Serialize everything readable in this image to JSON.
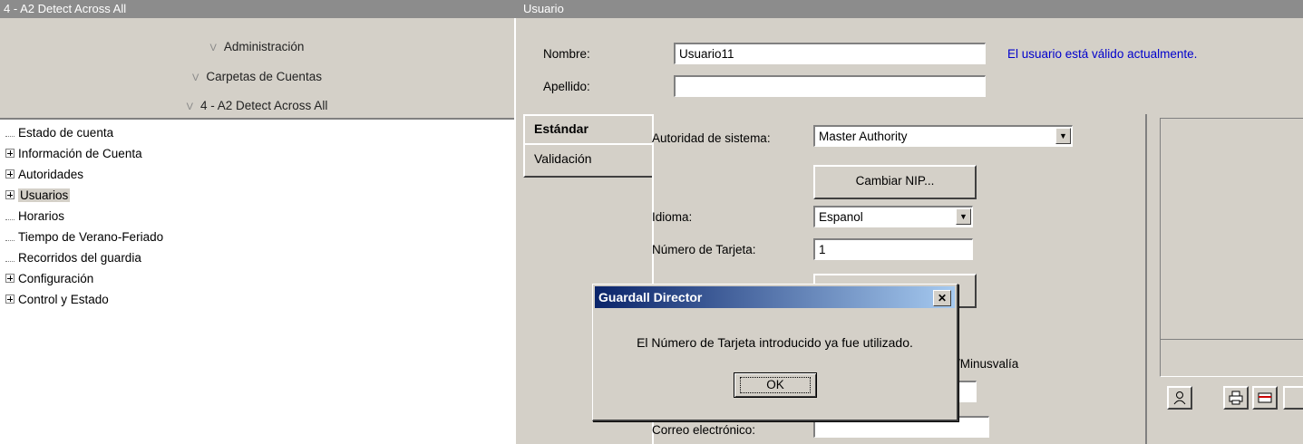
{
  "left": {
    "title": "4 - A2 Detect Across All",
    "nav": [
      "Administración",
      "Carpetas de Cuentas",
      "4 - A2 Detect Across All"
    ],
    "tree": [
      {
        "label": "Estado de cuenta",
        "expandable": false
      },
      {
        "label": "Información de Cuenta",
        "expandable": true
      },
      {
        "label": "Autoridades",
        "expandable": true
      },
      {
        "label": "Usuarios",
        "expandable": true,
        "selected": true
      },
      {
        "label": "Horarios",
        "expandable": false
      },
      {
        "label": "Tiempo de Verano-Feriado",
        "expandable": false
      },
      {
        "label": "Recorridos del guardia",
        "expandable": false
      },
      {
        "label": "Configuración",
        "expandable": true
      },
      {
        "label": "Control y Estado",
        "expandable": true
      }
    ]
  },
  "right": {
    "title": "Usuario",
    "nombre_label": "Nombre:",
    "nombre_value": "Usuario11",
    "apellido_label": "Apellido:",
    "apellido_value": "",
    "status": "El usuario está válido actualmente.",
    "tabs": [
      "Estándar",
      "Validación"
    ],
    "autoridad_label": "Autoridad de sistema:",
    "autoridad_value": "Master Authority",
    "cambiar_nip": "Cambiar NIP...",
    "idioma_label": "Idioma:",
    "idioma_value": "Espanol",
    "tarjeta_label": "Número de Tarjeta:",
    "tarjeta_value": "1",
    "minusvalia_partial": "/Minusvalía",
    "correo_label": "Correo electrónico:",
    "correo_value": ""
  },
  "dialog": {
    "title": "Guardall Director",
    "message": "El Número de Tarjeta introducido ya fue utilizado.",
    "ok": "OK",
    "close": "✕"
  },
  "colors": {
    "title_bar": "#8c8c8c",
    "face": "#d4d0c8",
    "status_text": "#0000cc",
    "dialog_title": "#0a246a"
  },
  "icons": [
    "user-photo-icon",
    "print-icon",
    "card-icon"
  ]
}
